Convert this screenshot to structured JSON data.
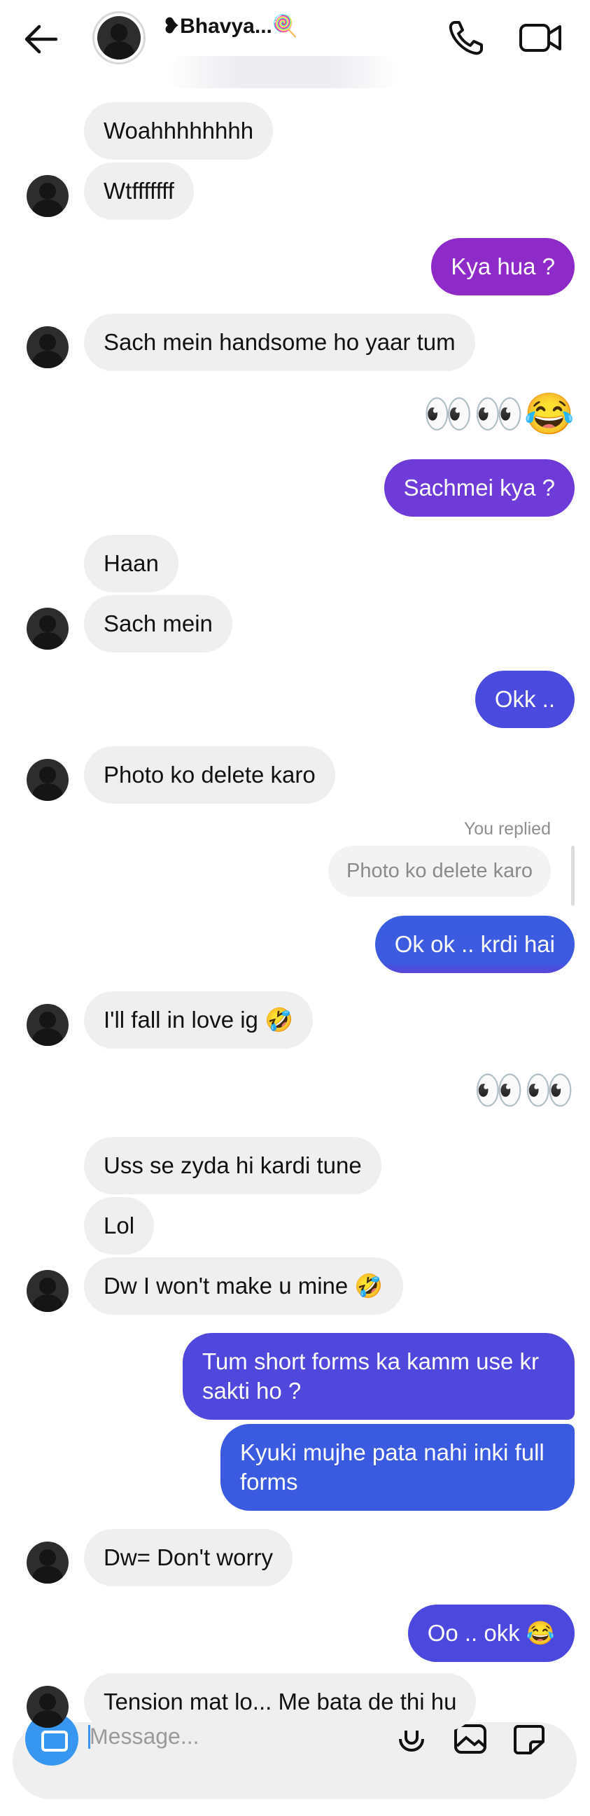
{
  "header": {
    "contact_name": "❥Bhavya...🍭"
  },
  "messages": {
    "m1": "Woahhhhhhhh",
    "m2": "Wtfffffff",
    "m3": "Kya hua ?",
    "m4": "Sach mein handsome ho yaar tum",
    "m5": "👀👀😂",
    "m6": "Sachmei kya ?",
    "m7": "Haan",
    "m8": "Sach mein",
    "m9": "Okk ..",
    "m10": "Photo ko delete karo",
    "reply_label": "You replied",
    "reply_quote": "Photo ko delete karo",
    "m11": "Ok ok .. krdi hai",
    "m12": "I'll fall in love ig 🤣",
    "m13": "👀👀",
    "m14": "Uss se zyda hi kardi tune",
    "m15": "Lol",
    "m16": "Dw I won't make u mine 🤣",
    "m17": "Tum short forms ka kamm use kr sakti ho ?",
    "m18": "Kyuki mujhe pata nahi inki full forms",
    "m19": "Dw= Don't worry",
    "m20": "Oo .. okk 😂",
    "m21": "Tension mat lo... Me bata de thi hu"
  },
  "composer": {
    "placeholder": "Message..."
  },
  "colors": {
    "incoming_bubble": "#efefef",
    "accent_blue": "#3797f0",
    "outgoing_gradient": [
      "#8f2bc9",
      "#6a3ad8",
      "#4c48de",
      "#3a5ae0"
    ]
  },
  "icons": [
    "back-arrow-icon",
    "phone-icon",
    "video-camera-icon",
    "camera-icon",
    "microphone-icon",
    "gallery-icon",
    "sticker-icon"
  ]
}
